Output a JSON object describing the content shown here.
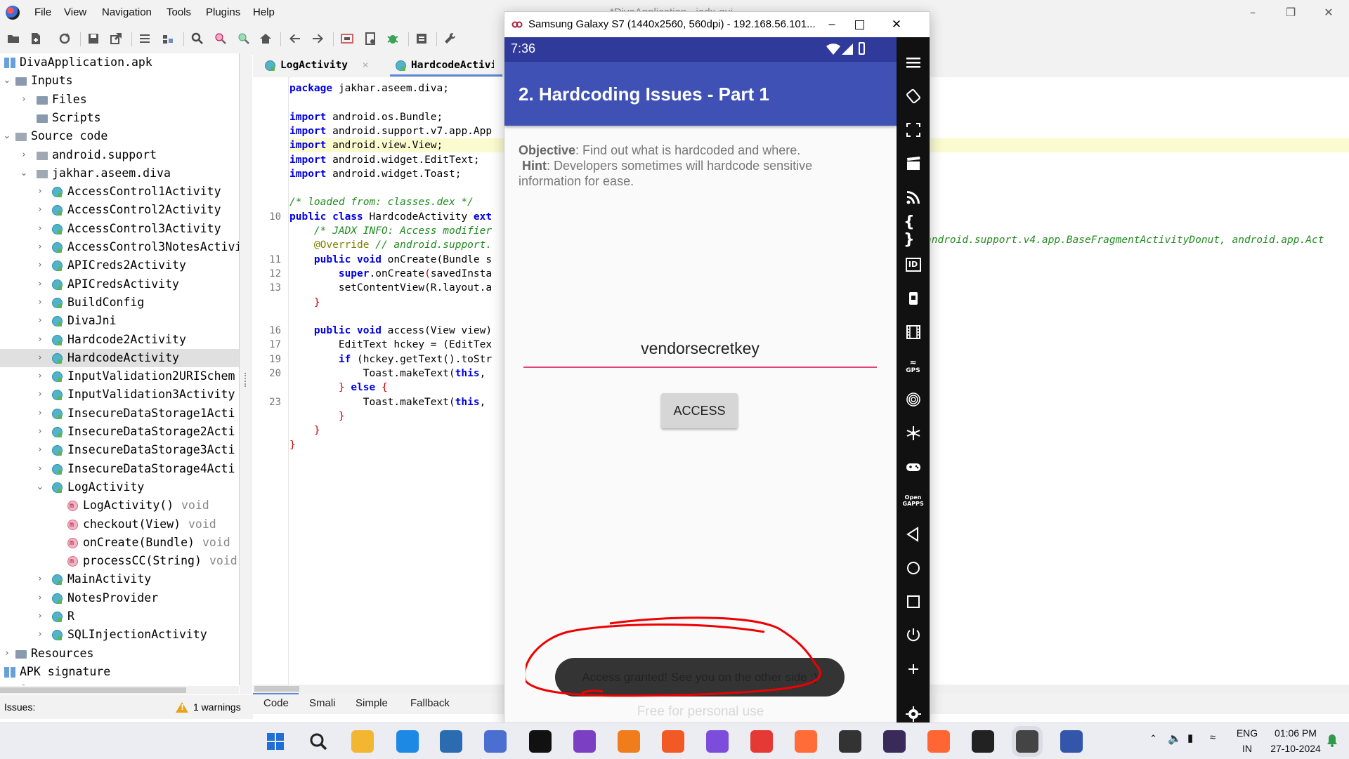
{
  "jadx": {
    "window_title": "*DivaApplication - jadx-gui",
    "menu": [
      "File",
      "View",
      "Navigation",
      "Tools",
      "Plugins",
      "Help"
    ],
    "tree": [
      {
        "label": "DivaApplication.apk",
        "depth": 0,
        "arrow": "",
        "icon": "apk"
      },
      {
        "label": "Inputs",
        "depth": 0,
        "arrow": "⌄",
        "icon": "folder"
      },
      {
        "label": "Files",
        "depth": 1,
        "arrow": "›",
        "icon": "folder"
      },
      {
        "label": "Scripts",
        "depth": 1,
        "arrow": "",
        "icon": "folder"
      },
      {
        "label": "Source code",
        "depth": 0,
        "arrow": "⌄",
        "icon": "pkg"
      },
      {
        "label": "android.support",
        "depth": 1,
        "arrow": "›",
        "icon": "pkg"
      },
      {
        "label": "jakhar.aseem.diva",
        "depth": 1,
        "arrow": "⌄",
        "icon": "pkg"
      },
      {
        "label": "AccessControl1Activity",
        "depth": 2,
        "arrow": "›",
        "icon": "cls"
      },
      {
        "label": "AccessControl2Activity",
        "depth": 2,
        "arrow": "›",
        "icon": "cls"
      },
      {
        "label": "AccessControl3Activity",
        "depth": 2,
        "arrow": "›",
        "icon": "cls"
      },
      {
        "label": "AccessControl3NotesActivi",
        "depth": 2,
        "arrow": "›",
        "icon": "cls"
      },
      {
        "label": "APICreds2Activity",
        "depth": 2,
        "arrow": "›",
        "icon": "cls"
      },
      {
        "label": "APICredsActivity",
        "depth": 2,
        "arrow": "›",
        "icon": "cls"
      },
      {
        "label": "BuildConfig",
        "depth": 2,
        "arrow": "›",
        "icon": "cls"
      },
      {
        "label": "DivaJni",
        "depth": 2,
        "arrow": "›",
        "icon": "cls"
      },
      {
        "label": "Hardcode2Activity",
        "depth": 2,
        "arrow": "›",
        "icon": "cls"
      },
      {
        "label": "HardcodeActivity",
        "depth": 2,
        "arrow": "›",
        "icon": "cls",
        "selected": true
      },
      {
        "label": "InputValidation2URISchem",
        "depth": 2,
        "arrow": "›",
        "icon": "cls"
      },
      {
        "label": "InputValidation3Activity",
        "depth": 2,
        "arrow": "›",
        "icon": "cls"
      },
      {
        "label": "InsecureDataStorage1Acti",
        "depth": 2,
        "arrow": "›",
        "icon": "cls"
      },
      {
        "label": "InsecureDataStorage2Acti",
        "depth": 2,
        "arrow": "›",
        "icon": "cls"
      },
      {
        "label": "InsecureDataStorage3Acti",
        "depth": 2,
        "arrow": "›",
        "icon": "cls"
      },
      {
        "label": "InsecureDataStorage4Acti",
        "depth": 2,
        "arrow": "›",
        "icon": "cls"
      },
      {
        "label": "LogActivity",
        "depth": 2,
        "arrow": "⌄",
        "icon": "cls"
      },
      {
        "label": "LogActivity()",
        "ret": "void",
        "depth": 3,
        "arrow": "",
        "icon": "meth"
      },
      {
        "label": "checkout(View)",
        "ret": "void",
        "depth": 3,
        "arrow": "",
        "icon": "meth"
      },
      {
        "label": "onCreate(Bundle)",
        "ret": "void",
        "depth": 3,
        "arrow": "",
        "icon": "meth"
      },
      {
        "label": "processCC(String)",
        "ret": "void",
        "depth": 3,
        "arrow": "",
        "icon": "meth"
      },
      {
        "label": "MainActivity",
        "depth": 2,
        "arrow": "›",
        "icon": "cls"
      },
      {
        "label": "NotesProvider",
        "depth": 2,
        "arrow": "›",
        "icon": "cls"
      },
      {
        "label": "R",
        "depth": 2,
        "arrow": "›",
        "icon": "cls"
      },
      {
        "label": "SQLInjectionActivity",
        "depth": 2,
        "arrow": "›",
        "icon": "cls"
      },
      {
        "label": "Resources",
        "depth": 0,
        "arrow": "›",
        "icon": "folder"
      },
      {
        "label": "APK signature",
        "depth": 0,
        "arrow": "",
        "icon": "apk"
      },
      {
        "label": "Summary",
        "depth": 0,
        "arrow": "",
        "icon": "folder"
      }
    ],
    "tabs": [
      {
        "label": "LogActivity",
        "close": "×"
      },
      {
        "label": "HardcodeActivit",
        "close": ""
      }
    ],
    "code_lines": [
      {
        "n": "",
        "html": "<span class='kw'>package</span> jakhar.aseem.diva;"
      },
      {
        "n": "",
        "html": ""
      },
      {
        "n": "",
        "html": "<span class='kw'>import</span> android.os.Bundle;"
      },
      {
        "n": "",
        "html": "<span class='kw'>import</span> android.support.v7.app.App"
      },
      {
        "n": "",
        "html": "<span class='kw'>import</span> android.view.View;",
        "hl": true
      },
      {
        "n": "",
        "html": "<span class='kw'>import</span> android.widget.EditText;"
      },
      {
        "n": "",
        "html": "<span class='kw'>import</span> android.widget.Toast;"
      },
      {
        "n": "",
        "html": ""
      },
      {
        "n": "",
        "html": "<span class='cm'>/* loaded from: classes.dex */</span>"
      },
      {
        "n": "10",
        "html": "<span class='kw'>public class</span> HardcodeActivity <span class='kw'>ext</span>"
      },
      {
        "n": "",
        "html": "    <span class='cm'>/* JADX INFO: Access modifier</span>"
      },
      {
        "n": "",
        "html": "    <span class='an'>@Override</span> <span class='cm'>// android.support.</span>"
      },
      {
        "n": "11",
        "html": "    <span class='kw'>public void</span> onCreate(Bundle s"
      },
      {
        "n": "12",
        "html": "        <span class='kw'>super</span>.onCreate<span class='red'>(</span>savedInsta"
      },
      {
        "n": "13",
        "html": "        setContentView(R.layout.a"
      },
      {
        "n": "",
        "html": "    <span class='red'>}</span>"
      },
      {
        "n": "",
        "html": ""
      },
      {
        "n": "16",
        "html": "    <span class='kw'>public void</span> access(View view)"
      },
      {
        "n": "17",
        "html": "        EditText hckey = (EditTex"
      },
      {
        "n": "19",
        "html": "        <span class='kw'>if</span> (hckey.getText().toStr"
      },
      {
        "n": "20",
        "html": "            Toast.makeText(<span class='kw'>this</span>,"
      },
      {
        "n": "",
        "html": "        <span class='red'>}</span> <span class='kw'>else</span> <span class='red'>{</span>"
      },
      {
        "n": "23",
        "html": "            Toast.makeText(<span class='kw'>this</span>,"
      },
      {
        "n": "",
        "html": "        <span class='red'>}</span>"
      },
      {
        "n": "",
        "html": "    <span class='red'>}</span>"
      },
      {
        "n": "",
        "html": "<span class='red'>}</span>"
      }
    ],
    "right_code_fragment": "android.support.v4.app.BaseFragmentActivityDonut, android.app.Act",
    "bottom_tabs": [
      "Code",
      "Smali",
      "Simple",
      "Fallback"
    ],
    "status": {
      "issues_label": "Issues:",
      "warnings": "1 warnings"
    }
  },
  "emulator": {
    "window_title": "Samsung Galaxy S7 (1440x2560, 560dpi) - 192.168.56.101...",
    "time": "7:36",
    "app_title": "2. Hardcoding Issues - Part 1",
    "objective_label": "Objective",
    "objective_text": ": Find out what is hardcoded and where.",
    "hint_label": "Hint",
    "hint_text": ": Developers sometimes will hardcode sensitive information for ease.",
    "input_value": "vendorsecretkey",
    "access_button": "ACCESS",
    "toast": "Access granted! See you on the other side :)",
    "watermark": "Free for personal use",
    "side_icons": [
      "menu-icon",
      "rotate-icon",
      "resize-icon",
      "clapper-icon",
      "rss-icon",
      "braces-icon",
      "id-icon",
      "phone-icon",
      "film-icon",
      "gps-icon",
      "fingerprint-icon",
      "network-icon",
      "gamepad-icon",
      "opengapps-icon",
      "back-icon",
      "home-icon",
      "recents-icon",
      "power-icon",
      "add-icon",
      "settings-icon"
    ],
    "gps_label": "GPS",
    "opengapps_label": "Open GAPPS",
    "id_label": "ID"
  },
  "taskbar": {
    "apps": [
      {
        "name": "windows-start-icon",
        "color": "#1f6fd6"
      },
      {
        "name": "search-icon",
        "color": "#333333"
      },
      {
        "name": "file-explorer-icon",
        "color": "#f2b630"
      },
      {
        "name": "vscode-icon",
        "color": "#1e88e5"
      },
      {
        "name": "cube-app-icon",
        "color": "#2b6cb0"
      },
      {
        "name": "tree-app-icon",
        "color": "#4a6fd1"
      },
      {
        "name": "notion-icon",
        "color": "#111111"
      },
      {
        "name": "camera-app-icon",
        "color": "#7b3fc4"
      },
      {
        "name": "fl-studio-icon",
        "color": "#f07c1b"
      },
      {
        "name": "brave-icon",
        "color": "#f15a24"
      },
      {
        "name": "obsidian-icon",
        "color": "#7c4ddb"
      },
      {
        "name": "youtube-music-icon",
        "color": "#e53935"
      },
      {
        "name": "postman-icon",
        "color": "#ff6c37"
      },
      {
        "name": "app-dark-icon",
        "color": "#333333"
      },
      {
        "name": "genymotion-icon",
        "color": "#3a2a5a"
      },
      {
        "name": "burpsuite-icon",
        "color": "#ff6633"
      },
      {
        "name": "terminal-icon",
        "color": "#222222"
      },
      {
        "name": "genymotion-active-icon",
        "color": "#444444"
      },
      {
        "name": "browser-app-icon",
        "color": "#3355aa"
      }
    ],
    "lang_top": "ENG",
    "lang_bottom": "IN",
    "time": "01:06 PM",
    "date": "27-10-2024"
  }
}
